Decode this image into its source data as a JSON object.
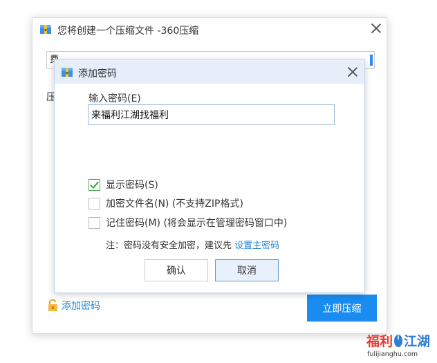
{
  "main_dialog": {
    "title": "您将创建一个压缩文件 -360压缩",
    "archive_path_visible": "费",
    "compress_label_visible": "压",
    "add_password_link": "添加密码",
    "compress_now_button": "立即压缩"
  },
  "password_dialog": {
    "title": "添加密码",
    "input_label": "输入密码(E)",
    "password_value": "来福利江湖找福利",
    "options": [
      {
        "label": "显示密码(S)",
        "checked": true
      },
      {
        "label": "加密文件名(N) (不支持ZIP格式)",
        "checked": false
      },
      {
        "label": "记住密码(M) (将会显示在管理密码窗口中)",
        "checked": false
      }
    ],
    "note_prefix": "注：密码没有安全加密，建议先 ",
    "note_link": "设置主密码",
    "ok_button": "确认",
    "cancel_button": "取消"
  },
  "watermark": {
    "text": "福利江湖",
    "url": "fulijianghu.com"
  },
  "colors": {
    "accent": "#1a8cf0",
    "link": "#1f86d8",
    "titlebar": "#e5eef9",
    "check": "#3d9f45"
  }
}
